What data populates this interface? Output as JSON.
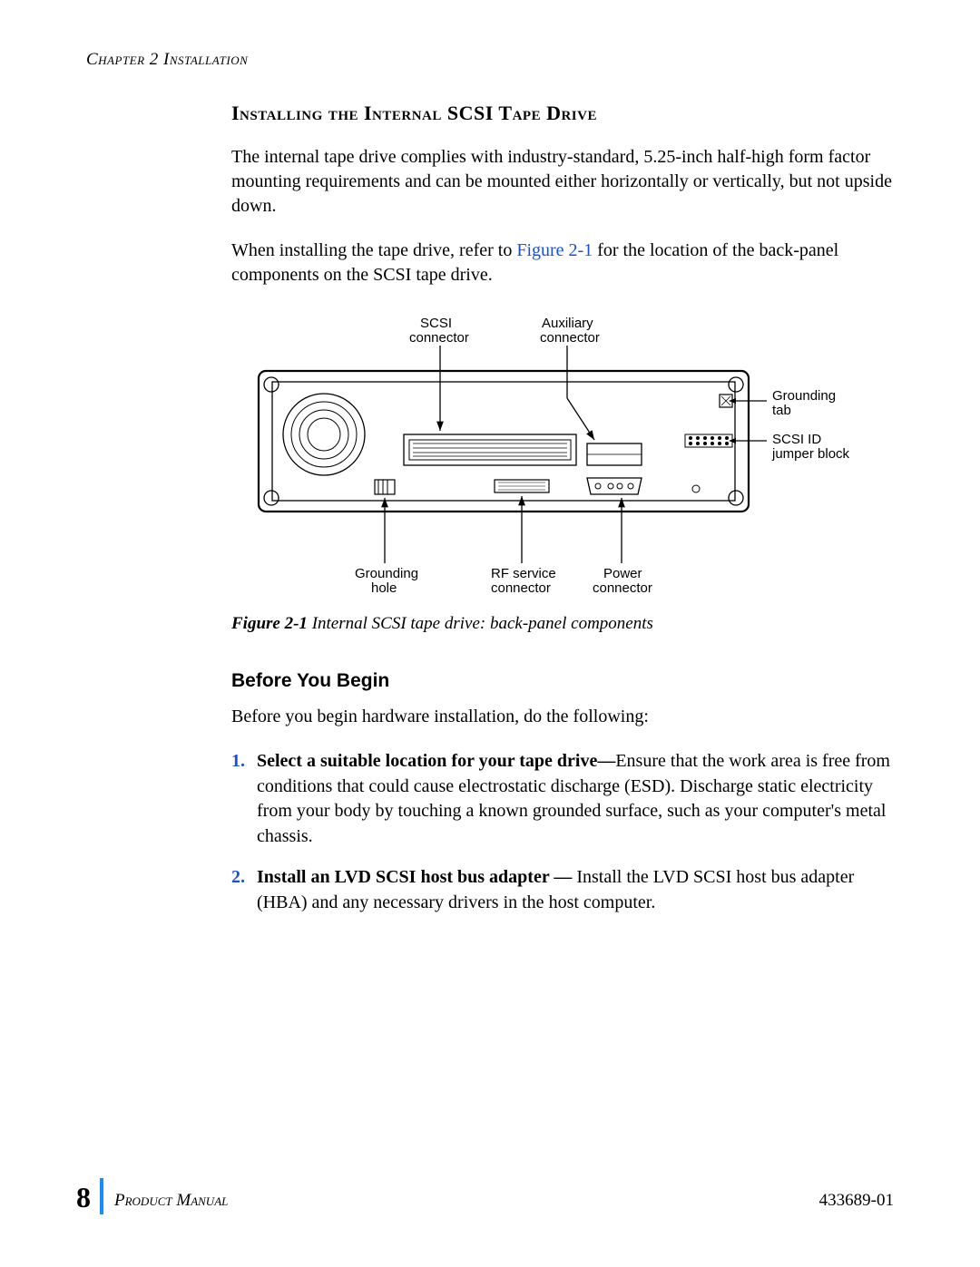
{
  "header": {
    "chapter": "Chapter 2   Installation"
  },
  "section_heading": "Installing the Internal SCSI Tape Drive",
  "para1": "The internal tape drive complies with industry-standard, 5.25-inch half-high form factor mounting requirements and can be mounted either horizontally or vertically, but not upside down.",
  "para2a": "When installing the tape drive, refer to ",
  "para2_link": "Figure 2-1",
  "para2b": " for the location of the back-panel components on the SCSI tape drive.",
  "figure": {
    "labels": {
      "scsi_connector_l1": "SCSI",
      "scsi_connector_l2": "connector",
      "aux_connector_l1": "Auxiliary",
      "aux_connector_l2": "connector",
      "grounding_tab_l1": "Grounding",
      "grounding_tab_l2": "tab",
      "scsi_id_l1": "SCSI ID",
      "scsi_id_l2": "jumper block",
      "grounding_hole_l1": "Grounding",
      "grounding_hole_l2": "hole",
      "rf_service_l1": "RF service",
      "rf_service_l2": "connector",
      "power_l1": "Power",
      "power_l2": "connector"
    },
    "caption_bold": "Figure 2-1",
    "caption_rest": "   Internal SCSI tape drive: back-panel components"
  },
  "subheading": "Before You Begin",
  "intro_line": "Before you begin hardware installation, do the following:",
  "steps": [
    {
      "num": "1.",
      "bold": "Select a suitable location for your tape drive—",
      "rest": "Ensure that the work area is free from conditions that could cause electrostatic discharge (ESD). Discharge static electricity from your body by touching a known grounded surface, such as your computer's metal chassis."
    },
    {
      "num": "2.",
      "bold": "Install an LVD SCSI host bus adapter — ",
      "rest": "Install the LVD SCSI host bus adapter (HBA) and any necessary drivers in the host computer."
    }
  ],
  "footer": {
    "page_number": "8",
    "product_manual": "Product Manual",
    "doc_number": "433689-01"
  }
}
